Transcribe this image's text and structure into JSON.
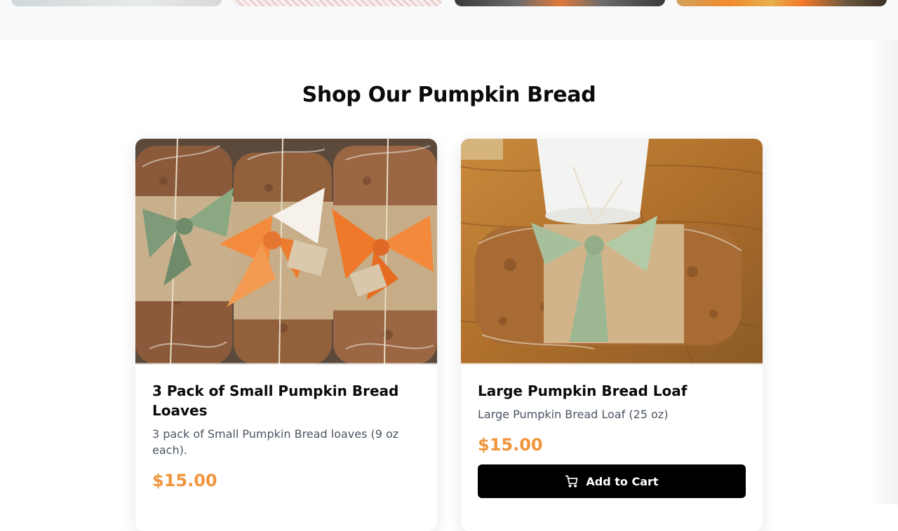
{
  "section": {
    "title": "Shop Our Pumpkin Bread"
  },
  "products": [
    {
      "name": "3 Pack of Small Pumpkin Bread Loaves",
      "description": "3 pack of Small Pumpkin Bread loaves (9 oz each).",
      "price": "$15.00",
      "image_icon": "pumpkin-bread-3-pack-photo"
    },
    {
      "name": "Large Pumpkin Bread Loaf",
      "description": "Large Pumpkin Bread Loaf (25 oz)",
      "price": "$15.00",
      "button_label": "Add to Cart",
      "button_icon": "cart-icon",
      "image_icon": "large-pumpkin-bread-photo"
    }
  ],
  "colors": {
    "price_accent": "#f0953d",
    "button_bg": "#000000",
    "page_bg": "#ffffff",
    "strip_bg": "#f8f9fb"
  }
}
